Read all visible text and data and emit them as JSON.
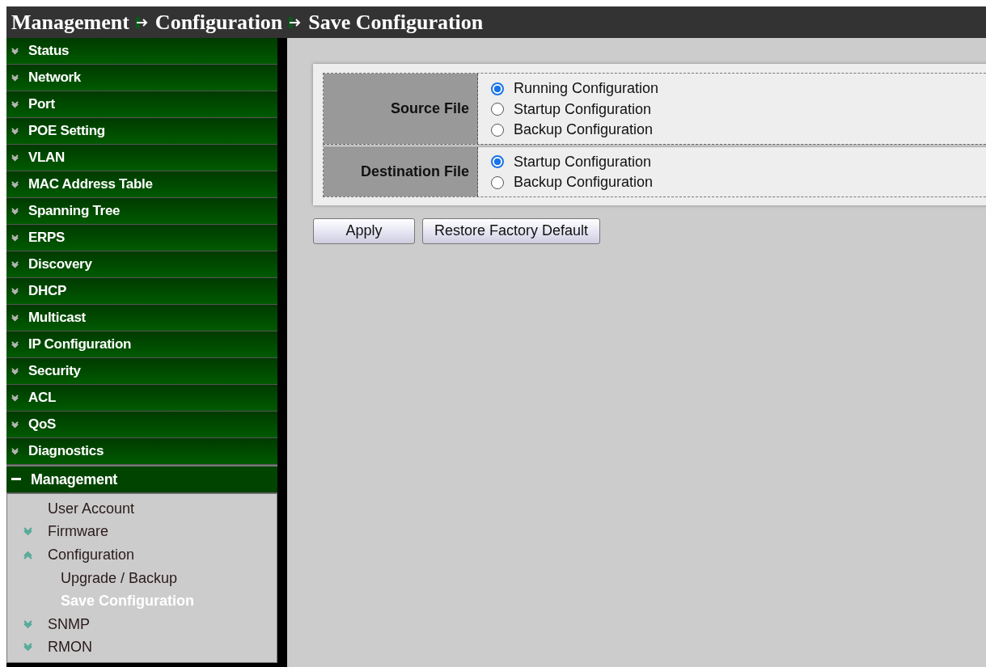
{
  "breadcrumb": [
    "Management",
    "Configuration",
    "Save Configuration"
  ],
  "sidebar": {
    "items": [
      {
        "label": "Status",
        "expanded": false
      },
      {
        "label": "Network",
        "expanded": false
      },
      {
        "label": "Port",
        "expanded": false
      },
      {
        "label": "POE Setting",
        "expanded": false
      },
      {
        "label": "VLAN",
        "expanded": false
      },
      {
        "label": "MAC Address Table",
        "expanded": false
      },
      {
        "label": "Spanning Tree",
        "expanded": false
      },
      {
        "label": "ERPS",
        "expanded": false
      },
      {
        "label": "Discovery",
        "expanded": false
      },
      {
        "label": "DHCP",
        "expanded": false
      },
      {
        "label": "Multicast",
        "expanded": false
      },
      {
        "label": "IP Configuration",
        "expanded": false
      },
      {
        "label": "Security",
        "expanded": false
      },
      {
        "label": "ACL",
        "expanded": false
      },
      {
        "label": "QoS",
        "expanded": false
      },
      {
        "label": "Diagnostics",
        "expanded": false
      },
      {
        "label": "Management",
        "expanded": true,
        "children": [
          {
            "label": "User Account",
            "kind": "page",
            "selected": false
          },
          {
            "label": "Firmware",
            "kind": "folder",
            "expanded": false
          },
          {
            "label": "Configuration",
            "kind": "folder",
            "expanded": true,
            "children": [
              {
                "label": "Upgrade / Backup",
                "selected": false
              },
              {
                "label": "Save Configuration",
                "selected": true
              }
            ]
          },
          {
            "label": "SNMP",
            "kind": "folder",
            "expanded": false
          },
          {
            "label": "RMON",
            "kind": "folder",
            "expanded": false
          }
        ]
      }
    ]
  },
  "form": {
    "rows": [
      {
        "label": "Source File",
        "options": [
          {
            "label": "Running Configuration",
            "selected": true
          },
          {
            "label": "Startup Configuration",
            "selected": false
          },
          {
            "label": "Backup Configuration",
            "selected": false
          }
        ]
      },
      {
        "label": "Destination File",
        "options": [
          {
            "label": "Startup Configuration",
            "selected": true
          },
          {
            "label": "Backup Configuration",
            "selected": false
          }
        ]
      }
    ]
  },
  "buttons": [
    "Apply",
    "Restore Factory Default"
  ]
}
